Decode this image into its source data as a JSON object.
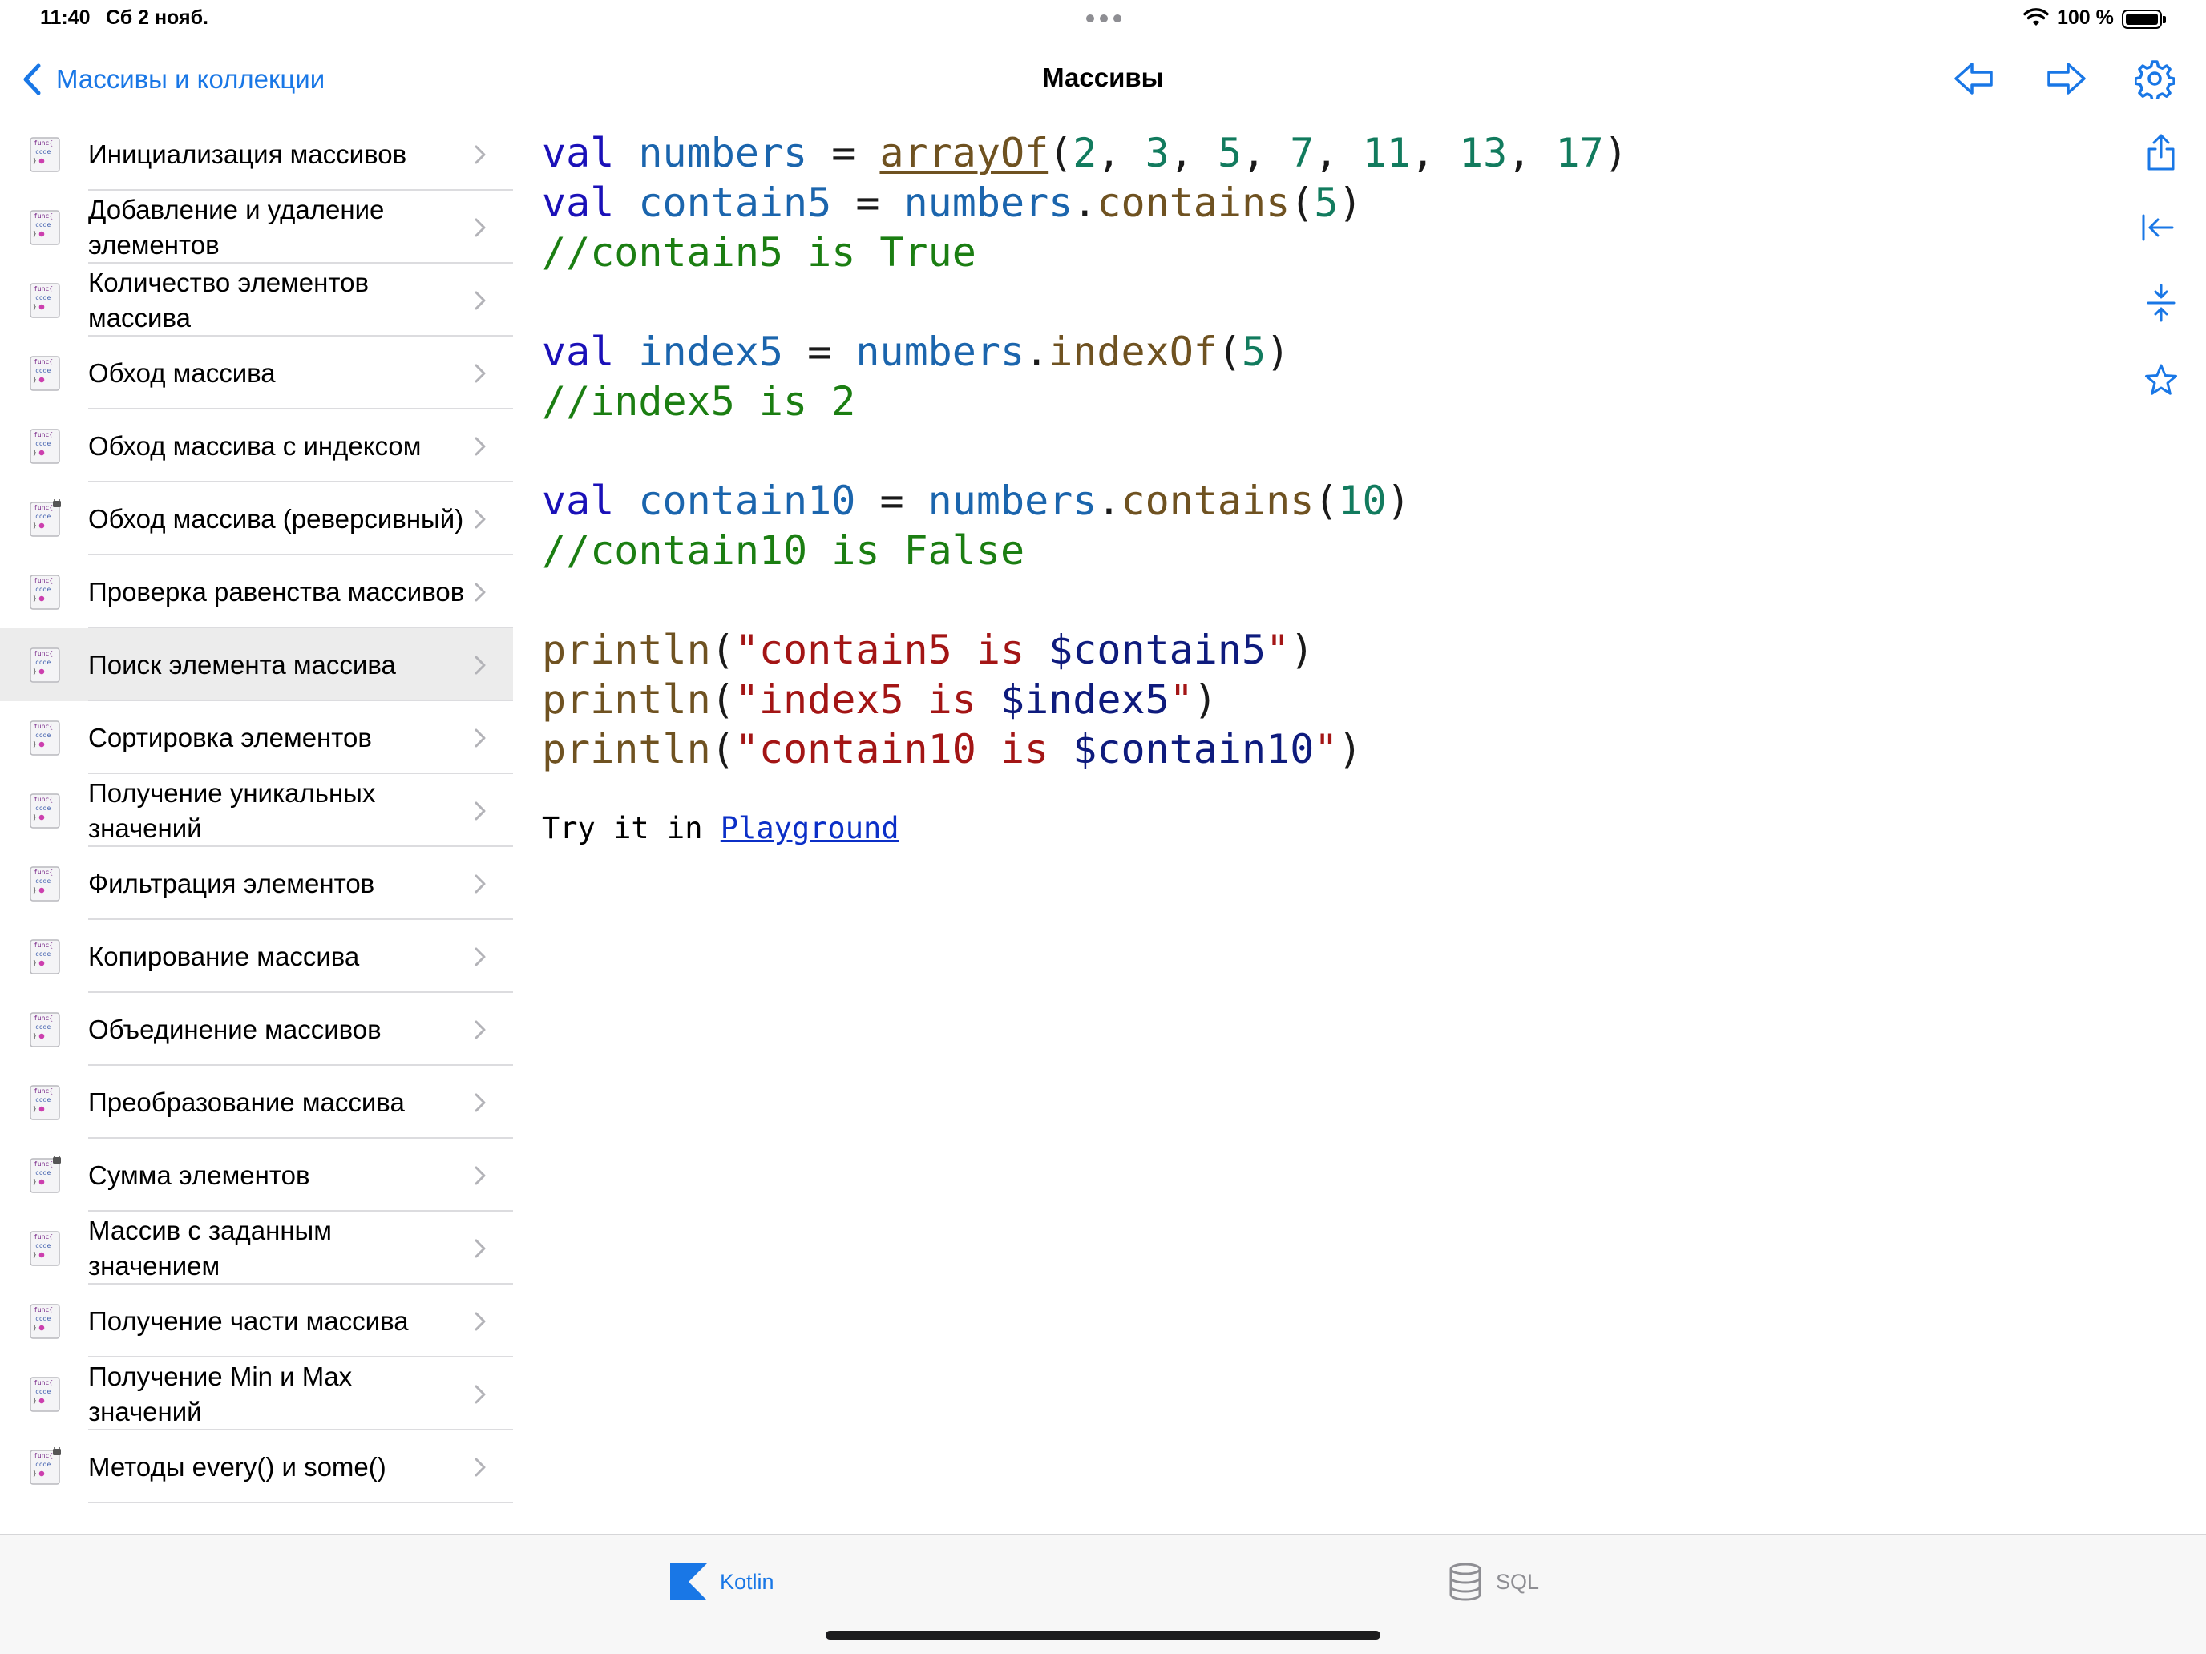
{
  "status_bar": {
    "time": "11:40",
    "date": "Сб 2 нояб.",
    "battery": "100 %"
  },
  "nav": {
    "back_label": "Массивы и коллекции",
    "title": "Массивы",
    "accent_color": "#1977e6"
  },
  "sidebar": {
    "items": [
      {
        "label": "Инициализация массивов",
        "locked": false
      },
      {
        "label": "Добавление и удаление элементов",
        "locked": false
      },
      {
        "label": "Количество элементов массива",
        "locked": false
      },
      {
        "label": "Обход массива",
        "locked": false
      },
      {
        "label": "Обход массива с индексом",
        "locked": false
      },
      {
        "label": "Обход массива (реверсивный)",
        "locked": true
      },
      {
        "label": "Проверка равенства массивов",
        "locked": false
      },
      {
        "label": "Поиск элемента массива",
        "locked": false,
        "selected": true
      },
      {
        "label": "Сортировка элементов",
        "locked": false
      },
      {
        "label": "Получение уникальных значений",
        "locked": false
      },
      {
        "label": "Фильтрация элементов",
        "locked": false
      },
      {
        "label": "Копирование массива",
        "locked": false
      },
      {
        "label": "Объединение массивов",
        "locked": false
      },
      {
        "label": "Преобразование массива",
        "locked": false
      },
      {
        "label": "Сумма элементов",
        "locked": true
      },
      {
        "label": "Массив с заданным значением",
        "locked": false
      },
      {
        "label": "Получение части массива",
        "locked": false
      },
      {
        "label": "Получение Min и Max значений",
        "locked": false
      },
      {
        "label": "Методы every() и some()",
        "locked": true
      }
    ]
  },
  "code": {
    "lines": [
      [
        [
          "kw",
          "val"
        ],
        [
          "op",
          " "
        ],
        [
          "id",
          "numbers"
        ],
        [
          "op",
          " = "
        ],
        [
          "fn-u",
          "arrayOf"
        ],
        [
          "op",
          "("
        ],
        [
          "num",
          "2"
        ],
        [
          "op",
          ", "
        ],
        [
          "num",
          "3"
        ],
        [
          "op",
          ", "
        ],
        [
          "num",
          "5"
        ],
        [
          "op",
          ", "
        ],
        [
          "num",
          "7"
        ],
        [
          "op",
          ", "
        ],
        [
          "num",
          "11"
        ],
        [
          "op",
          ", "
        ],
        [
          "num",
          "13"
        ],
        [
          "op",
          ", "
        ],
        [
          "num",
          "17"
        ],
        [
          "op",
          ")"
        ]
      ],
      [
        [
          "kw",
          "val"
        ],
        [
          "op",
          " "
        ],
        [
          "id",
          "contain5"
        ],
        [
          "op",
          " = "
        ],
        [
          "id",
          "numbers"
        ],
        [
          "op",
          "."
        ],
        [
          "fn",
          "contains"
        ],
        [
          "op",
          "("
        ],
        [
          "num",
          "5"
        ],
        [
          "op",
          ")"
        ]
      ],
      [
        [
          "cm",
          "//contain5 is True"
        ]
      ],
      [],
      [
        [
          "kw",
          "val"
        ],
        [
          "op",
          " "
        ],
        [
          "id",
          "index5"
        ],
        [
          "op",
          " = "
        ],
        [
          "id",
          "numbers"
        ],
        [
          "op",
          "."
        ],
        [
          "fn",
          "indexOf"
        ],
        [
          "op",
          "("
        ],
        [
          "num",
          "5"
        ],
        [
          "op",
          ")"
        ]
      ],
      [
        [
          "cm",
          "//index5 is 2"
        ]
      ],
      [],
      [
        [
          "kw",
          "val"
        ],
        [
          "op",
          " "
        ],
        [
          "id",
          "contain10"
        ],
        [
          "op",
          " = "
        ],
        [
          "id",
          "numbers"
        ],
        [
          "op",
          "."
        ],
        [
          "fn",
          "contains"
        ],
        [
          "op",
          "("
        ],
        [
          "num",
          "10"
        ],
        [
          "op",
          ")"
        ]
      ],
      [
        [
          "cm",
          "//contain10 is False"
        ]
      ],
      [],
      [
        [
          "fn",
          "println"
        ],
        [
          "op",
          "("
        ],
        [
          "str",
          "\"contain5 is "
        ],
        [
          "tmpl",
          "$contain5"
        ],
        [
          "str",
          "\""
        ],
        [
          "op",
          ")"
        ]
      ],
      [
        [
          "fn",
          "println"
        ],
        [
          "op",
          "("
        ],
        [
          "str",
          "\"index5 is "
        ],
        [
          "tmpl",
          "$index5"
        ],
        [
          "str",
          "\""
        ],
        [
          "op",
          ")"
        ]
      ],
      [
        [
          "fn",
          "println"
        ],
        [
          "op",
          "("
        ],
        [
          "str",
          "\"contain10 is "
        ],
        [
          "tmpl",
          "$contain10"
        ],
        [
          "str",
          "\""
        ],
        [
          "op",
          ")"
        ]
      ]
    ],
    "try_prefix": "Try it in ",
    "try_link": "Playground"
  },
  "tabs": [
    {
      "label": "Kotlin",
      "active": true
    },
    {
      "label": "SQL",
      "active": false
    }
  ],
  "icons": {
    "nav_prev": "arrow-left-icon",
    "nav_next": "arrow-right-icon",
    "settings": "gear-icon",
    "share": "share-icon",
    "collapse": "arrow-left-to-line-icon",
    "font_size": "compress-vertical-icon",
    "favorite": "star-icon",
    "item": "func-code-icon",
    "kotlin_tab": "kotlin-logo-icon",
    "sql_tab": "database-icon"
  }
}
